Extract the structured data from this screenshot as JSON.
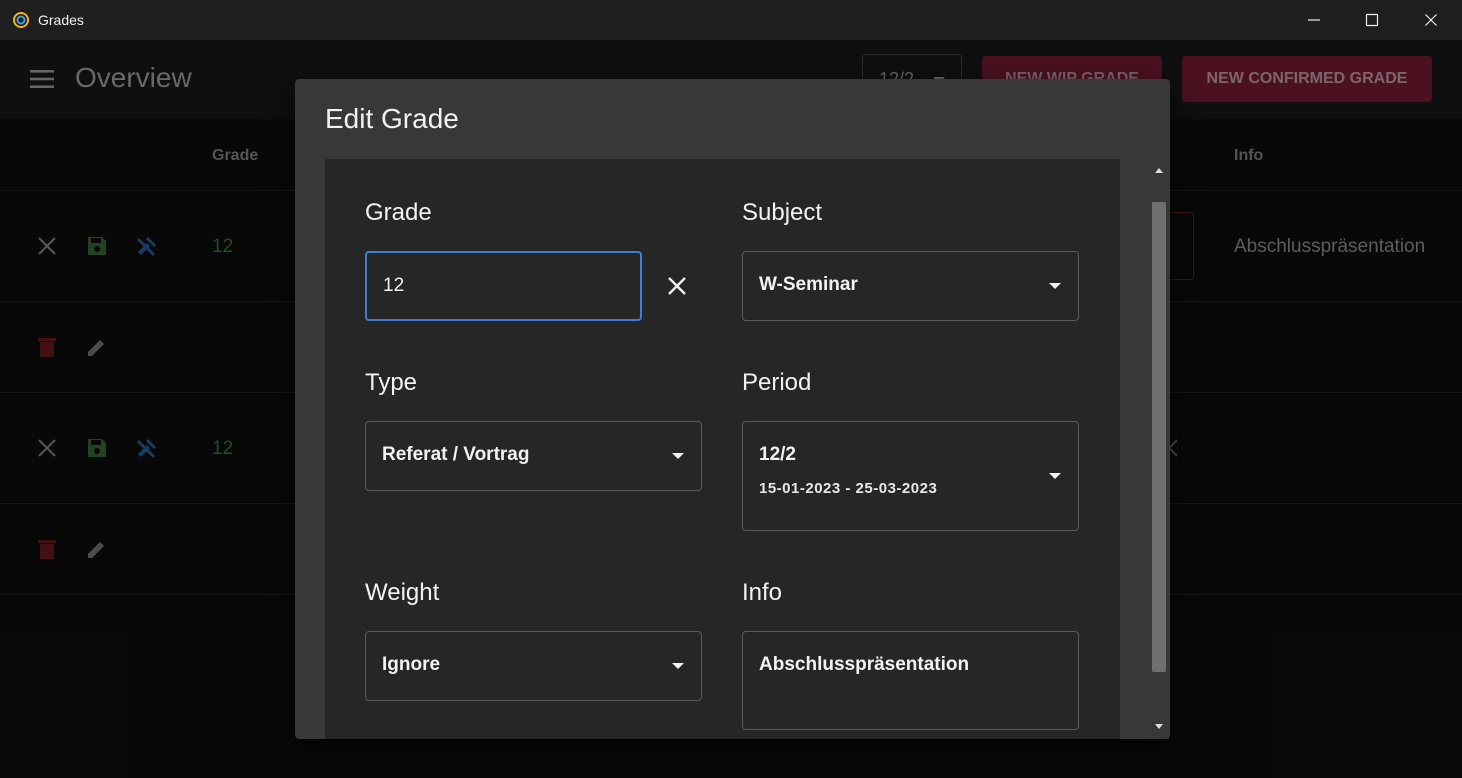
{
  "window": {
    "title": "Grades",
    "minimize_icon": "minimize-icon",
    "maximize_icon": "maximize-icon",
    "close_icon": "close-icon"
  },
  "header": {
    "title": "Overview",
    "period_value": "12/2",
    "new_wip_label": "NEW WIP GRADE",
    "new_confirmed_label": "NEW CONFIRMED GRADE",
    "accent_color": "#8a1f3d"
  },
  "table": {
    "columns": {
      "grade": "Grade",
      "info": "Info"
    },
    "rows": [
      {
        "grade": "12",
        "info": "Abschlusspräsentation"
      },
      {
        "grade": "12",
        "info": ""
      }
    ]
  },
  "dialog": {
    "title": "Edit Grade",
    "grade": {
      "label": "Grade",
      "value": "12"
    },
    "subject": {
      "label": "Subject",
      "value": "W-Seminar"
    },
    "type": {
      "label": "Type",
      "value": "Referat / Vortrag"
    },
    "period": {
      "label": "Period",
      "value": "12/2",
      "range": "15-01-2023 - 25-03-2023"
    },
    "weight": {
      "label": "Weight",
      "value": "Ignore"
    },
    "info": {
      "label": "Info",
      "value": "Abschlusspräsentation"
    },
    "focus_color": "#3d7fd6"
  }
}
